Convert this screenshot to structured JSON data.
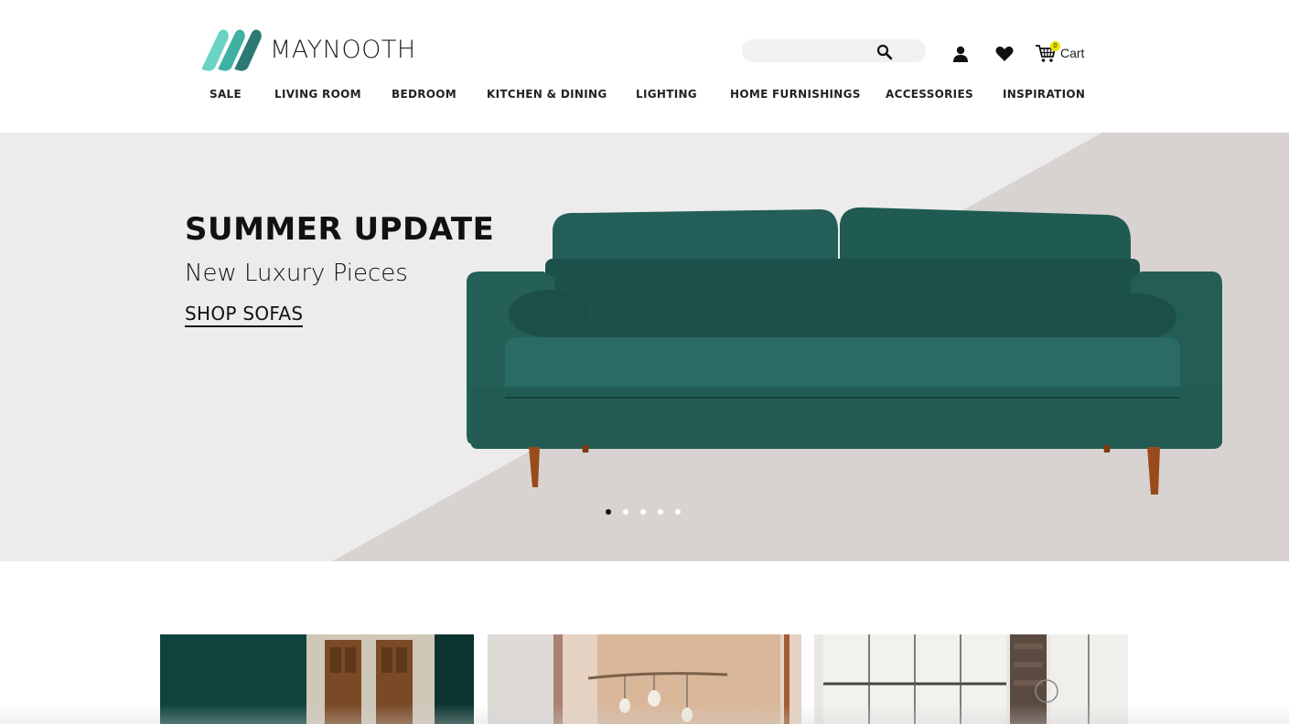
{
  "brand": {
    "name": "MAYNOOTH",
    "logo_colors": [
      "#6ad3c3",
      "#3fb1a3",
      "#2b7a73"
    ]
  },
  "header": {
    "search": {
      "placeholder": "",
      "value": "",
      "icon": "search-icon"
    },
    "account_icon": "user-icon",
    "wishlist_icon": "heart-icon",
    "cart": {
      "label": "Cart",
      "count": "0",
      "icon": "cart-icon"
    }
  },
  "nav": {
    "items": [
      {
        "label": "SALE"
      },
      {
        "label": "LIVING ROOM"
      },
      {
        "label": "BEDROOM"
      },
      {
        "label": "KITCHEN & DINING"
      },
      {
        "label": "LIGHTING"
      },
      {
        "label": "HOME FURNISHINGS"
      },
      {
        "label": "ACCESSORIES"
      },
      {
        "label": "INSPIRATION"
      }
    ]
  },
  "hero": {
    "title": "SUMMER UPDATE",
    "subtitle": "New Luxury Pieces",
    "cta": "SHOP SOFAS",
    "background_color": "#ececec",
    "accent_color": "#d8d3d1",
    "sofa_color": "#1f5b55",
    "slides_total": 5,
    "active_slide": 1
  },
  "category_tiles": [
    {
      "name": "green-doorway-tile"
    },
    {
      "name": "pendant-lights-tile"
    },
    {
      "name": "window-loft-tile"
    }
  ]
}
